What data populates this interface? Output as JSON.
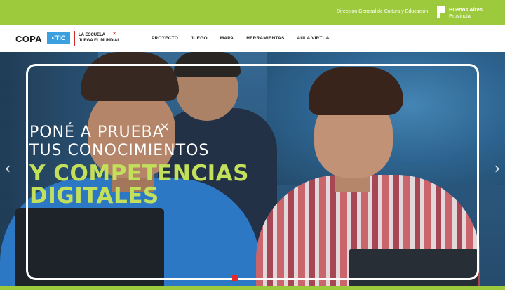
{
  "topbar": {
    "direction_label": "Dirección General de Cultura y Educación",
    "province_line1": "Buenos Aires",
    "province_line2": "Provincia",
    "bg_color": "#9dca3c"
  },
  "brand": {
    "copa": "COPA",
    "tic": "<TIC",
    "escuela_line1": "LA ESCUELA",
    "escuela_line2": "JUEGA EL MUNDIAL",
    "x": "×"
  },
  "nav": {
    "items": [
      {
        "label": "PROYECTO"
      },
      {
        "label": "JUEGO"
      },
      {
        "label": "MAPA"
      },
      {
        "label": "HERRAMIENTAS"
      },
      {
        "label": "AULA VIRTUAL"
      }
    ]
  },
  "hero": {
    "line1": "PONÉ A PRUEBA",
    "line2": "TUS CONOCIMIENTOS",
    "line3": "Y COMPETENCIAS",
    "line4": "DIGITALES",
    "x_mark": "×",
    "accent_color": "#c3e05a",
    "prev_arrow": "‹",
    "next_arrow": "›"
  }
}
